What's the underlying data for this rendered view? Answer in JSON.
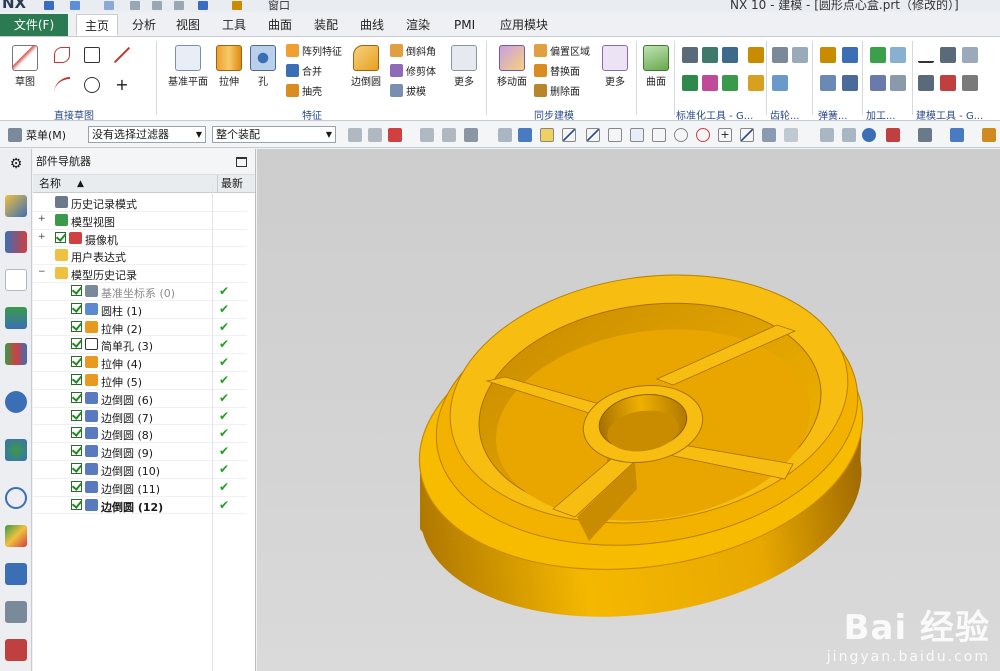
{
  "app": {
    "logo": "NX",
    "window_title": "NX 10 - 建模 - [圆形点心盒.prt（修改的）]",
    "window_menu": "窗口"
  },
  "tabs": [
    "文件(F)",
    "主页",
    "分析",
    "视图",
    "工具",
    "曲面",
    "装配",
    "曲线",
    "渲染",
    "PMI",
    "应用模块"
  ],
  "active_tab": "主页",
  "ribbon": {
    "sketch": {
      "label": "草图",
      "group": "直接草图"
    },
    "feature": {
      "datum_plane": "基准平面",
      "extrude": "拉伸",
      "hole": "孔",
      "pattern": "阵列特征",
      "unite": "合并",
      "shell": "抽壳",
      "edge_blend": "边倒圆",
      "chamfer": "倒斜角",
      "trim_body": "修剪体",
      "draft": "拔模",
      "more": "更多",
      "group": "特征"
    },
    "sync": {
      "move_face": "移动面",
      "offset_region": "偏置区域",
      "replace_face": "替换面",
      "delete_face": "删除面",
      "more": "更多",
      "group": "同步建模"
    },
    "surface": {
      "label": "曲面"
    },
    "group_labels": [
      "标准化工具 - G...",
      "齿轮...",
      "弹簧...",
      "加工...",
      "建模工具 - G..."
    ]
  },
  "selection_bar": {
    "menu": "菜单(M)",
    "filter": "没有选择过滤器",
    "scope": "整个装配"
  },
  "navigator": {
    "title": "部件导航器",
    "col_name": "名称",
    "col_latest": "最新",
    "rows": [
      {
        "label": "历史记录模式",
        "type": "history-mode"
      },
      {
        "label": "模型视图",
        "type": "model-views"
      },
      {
        "label": "摄像机",
        "type": "cameras"
      },
      {
        "label": "用户表达式",
        "type": "user-expressions"
      },
      {
        "label": "模型历史记录",
        "type": "model-history"
      },
      {
        "label": "基准坐标系 (0)",
        "type": "datum-csys"
      },
      {
        "label": "圆柱 (1)",
        "type": "cylinder"
      },
      {
        "label": "拉伸 (2)",
        "type": "extrude"
      },
      {
        "label": "简单孔 (3)",
        "type": "simple-hole"
      },
      {
        "label": "拉伸 (4)",
        "type": "extrude"
      },
      {
        "label": "拉伸 (5)",
        "type": "extrude"
      },
      {
        "label": "边倒圆 (6)",
        "type": "edge-blend"
      },
      {
        "label": "边倒圆 (7)",
        "type": "edge-blend"
      },
      {
        "label": "边倒圆 (8)",
        "type": "edge-blend"
      },
      {
        "label": "边倒圆 (9)",
        "type": "edge-blend"
      },
      {
        "label": "边倒圆 (10)",
        "type": "edge-blend"
      },
      {
        "label": "边倒圆 (11)",
        "type": "edge-blend"
      },
      {
        "label": "边倒圆 (12)",
        "type": "edge-blend"
      }
    ]
  },
  "watermark": {
    "brand": "Bai 经验",
    "url": "jingyan.baidu.com"
  },
  "colors": {
    "file_tab": "#2c7a52",
    "part": "#f5b800",
    "part_dark": "#c98c00",
    "viewport": "#d2d2d2"
  }
}
